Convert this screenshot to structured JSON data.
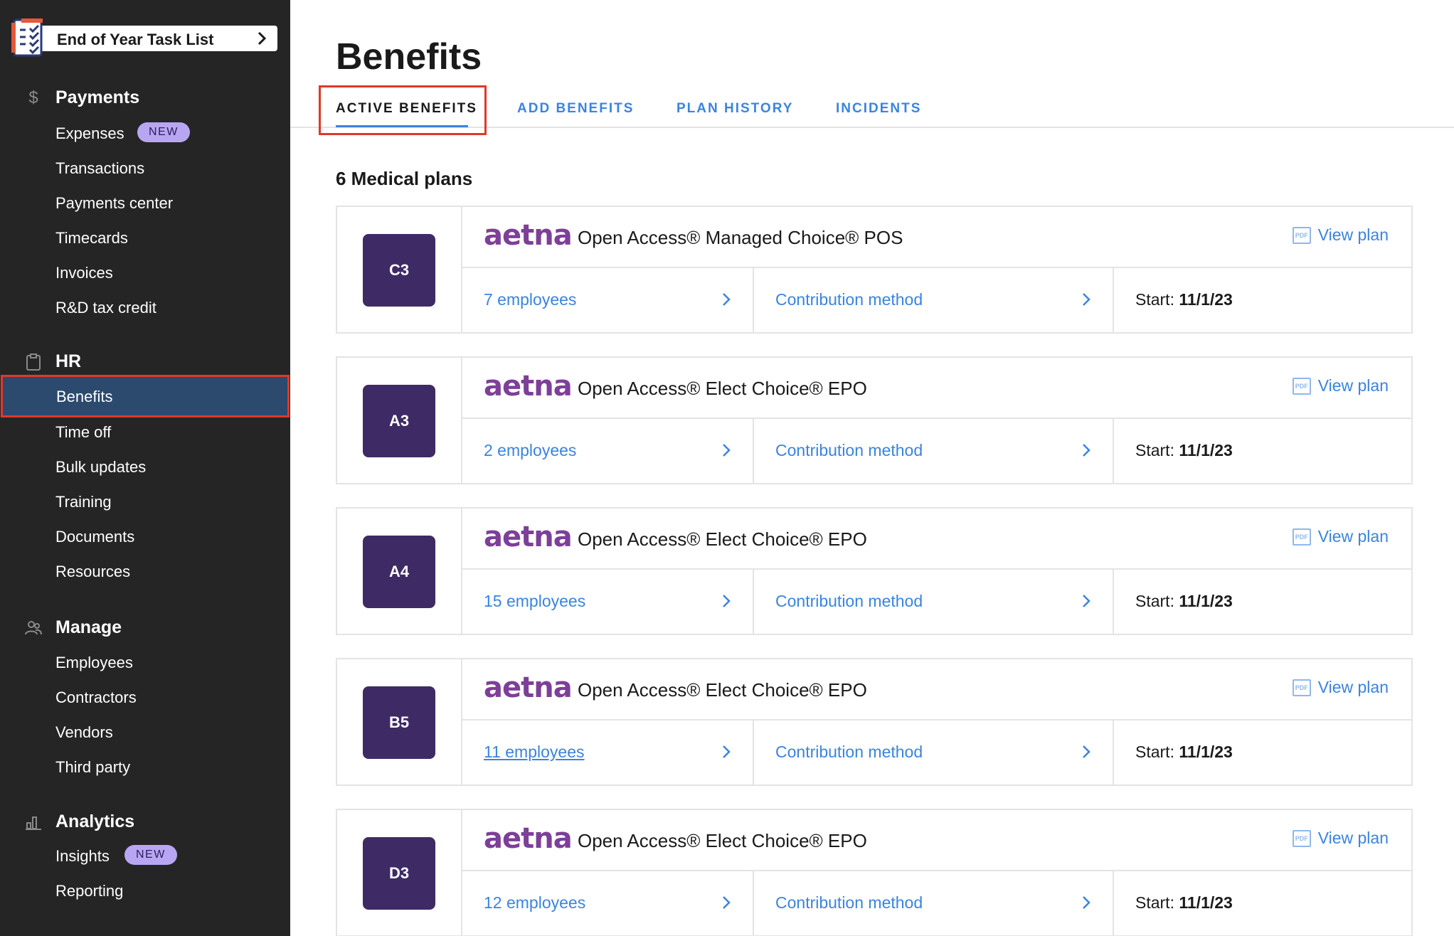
{
  "sidebar": {
    "task_list": {
      "label": "End of Year Task List"
    },
    "sections": {
      "payments": {
        "label": "Payments",
        "items": [
          {
            "label": "Expenses",
            "badge": "NEW"
          },
          {
            "label": "Transactions"
          },
          {
            "label": "Payments center"
          },
          {
            "label": "Timecards"
          },
          {
            "label": "Invoices"
          },
          {
            "label": "R&D tax credit"
          }
        ]
      },
      "hr": {
        "label": "HR",
        "items": [
          {
            "label": "Benefits",
            "active": true
          },
          {
            "label": "Time off"
          },
          {
            "label": "Bulk updates"
          },
          {
            "label": "Training"
          },
          {
            "label": "Documents"
          },
          {
            "label": "Resources"
          }
        ]
      },
      "manage": {
        "label": "Manage",
        "items": [
          {
            "label": "Employees"
          },
          {
            "label": "Contractors"
          },
          {
            "label": "Vendors"
          },
          {
            "label": "Third party"
          }
        ]
      },
      "analytics": {
        "label": "Analytics",
        "items": [
          {
            "label": "Insights",
            "badge": "NEW"
          },
          {
            "label": "Reporting"
          }
        ]
      }
    }
  },
  "main": {
    "title": "Benefits",
    "tabs": [
      {
        "label": "ACTIVE BENEFITS",
        "active": true
      },
      {
        "label": "ADD BENEFITS"
      },
      {
        "label": "PLAN HISTORY"
      },
      {
        "label": "INCIDENTS"
      }
    ],
    "section_title": "6 Medical plans",
    "plans": [
      {
        "code": "C3",
        "logo": "aetna",
        "name": "Open Access® Managed Choice® POS",
        "view_plan": "View plan",
        "employees": "7 employees",
        "contribution": "Contribution method",
        "start_label": "Start:",
        "start_date": "11/1/23"
      },
      {
        "code": "A3",
        "logo": "aetna",
        "name": "Open Access® Elect Choice® EPO",
        "view_plan": "View plan",
        "employees": "2 employees",
        "contribution": "Contribution method",
        "start_label": "Start:",
        "start_date": "11/1/23"
      },
      {
        "code": "A4",
        "logo": "aetna",
        "name": "Open Access® Elect Choice® EPO",
        "view_plan": "View plan",
        "employees": "15 employees",
        "contribution": "Contribution method",
        "start_label": "Start:",
        "start_date": "11/1/23"
      },
      {
        "code": "B5",
        "logo": "aetna",
        "name": "Open Access® Elect Choice® EPO",
        "view_plan": "View plan",
        "employees": "11 employees",
        "contribution": "Contribution method",
        "start_label": "Start:",
        "start_date": "11/1/23"
      },
      {
        "code": "D3",
        "logo": "aetna",
        "name": "Open Access® Elect Choice® EPO",
        "view_plan": "View plan",
        "employees": "12 employees",
        "contribution": "Contribution method",
        "start_label": "Start:",
        "start_date": "11/1/23"
      }
    ]
  },
  "colors": {
    "sidebar_bg": "#252526",
    "active_nav_bg": "#2b4a6e",
    "highlight_red": "#e0382a",
    "link_blue": "#3a84e0",
    "plan_code_bg": "#3e2a64",
    "aetna_purple": "#7d3f98",
    "badge_bg": "#b9a6f3"
  },
  "icons": {
    "task_list": "checklist-icon",
    "payments": "dollar-icon",
    "hr": "clipboard-icon",
    "manage": "people-icon",
    "analytics": "bar-chart-icon",
    "pdf": "pdf-icon",
    "chevron": "chevron-right-icon"
  }
}
